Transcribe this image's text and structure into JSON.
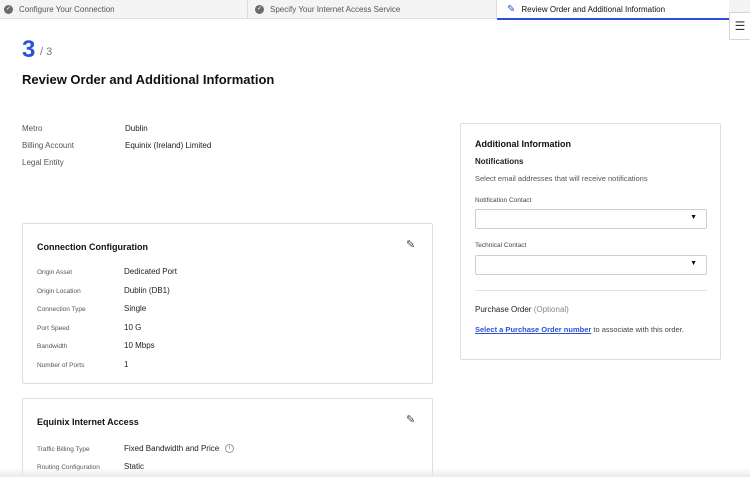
{
  "stepper": {
    "steps": [
      {
        "label": "Configure Your Connection",
        "state": "complete",
        "icon": "check-circle-icon"
      },
      {
        "label": "Specify Your Internet Access Service",
        "state": "complete",
        "icon": "check-circle-icon"
      },
      {
        "label": "Review Order and Additional Information",
        "state": "active",
        "icon": "pencil-icon"
      }
    ],
    "menu_icon": "hamburger-icon"
  },
  "header": {
    "step_number": "3",
    "step_total": "/ 3",
    "title": "Review Order and Additional Information"
  },
  "summary": {
    "metro_label": "Metro",
    "metro_value": "Dublin",
    "billing_label": "Billing Account",
    "billing_value": "Equinix (Ireland) Limited",
    "legal_label": "Legal Entity"
  },
  "connection_config": {
    "title": "Connection Configuration",
    "rows": [
      {
        "label": "Origin Asset",
        "value": "Dedicated Port"
      },
      {
        "label": "Origin Location",
        "value": "Dublin (DB1)"
      },
      {
        "label": "Connection Type",
        "value": "Single"
      },
      {
        "label": "Port Speed",
        "value": "10 G"
      },
      {
        "label": "Bandwidth",
        "value": "10 Mbps"
      },
      {
        "label": "Number of Ports",
        "value": "1"
      }
    ]
  },
  "internet_access": {
    "title": "Equinix Internet Access",
    "rows": [
      {
        "label": "Traffic Billing Type",
        "value": "Fixed Bandwidth and Price"
      },
      {
        "label": "Routing Configuration",
        "value": "Static"
      }
    ]
  },
  "additional_info": {
    "title": "Additional Information",
    "notifications_title": "Notifications",
    "notifications_desc": "Select email addresses that will receive notifications",
    "notification_contact_label": "Notification Contact",
    "technical_contact_label": "Technical Contact",
    "po_title": "Purchase Order",
    "po_optional": "(Optional)",
    "po_link": "Select a Purchase Order number",
    "po_suffix": " to associate with this order."
  },
  "colors": {
    "accent": "#2a52d6",
    "border": "#dedede"
  }
}
